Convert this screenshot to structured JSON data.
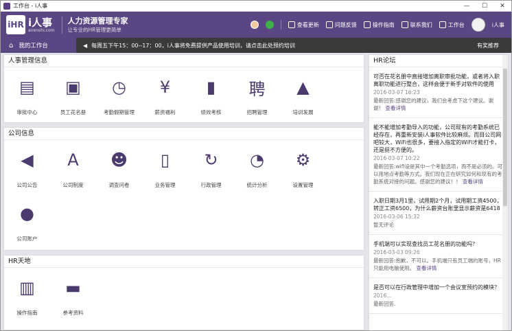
{
  "window": {
    "title": "工作台 - i人事",
    "min": "—",
    "max": "☐",
    "close": "✕"
  },
  "header": {
    "logo_mark": "iHR",
    "logo_name": "i人事",
    "logo_site": "airenshi.com",
    "slogan_main": "人力资源管理专家",
    "slogan_sub": "让专业的HR管理更简单",
    "actions": [
      {
        "label": "查看更新",
        "icon": "update-icon"
      },
      {
        "label": "问题反馈",
        "icon": "feedback-icon"
      },
      {
        "label": "操作指南",
        "icon": "book-icon"
      },
      {
        "label": "联系我们",
        "icon": "phone-icon"
      },
      {
        "label": "工作台",
        "icon": "home-icon"
      }
    ],
    "user": "i人事"
  },
  "nav": {
    "home": "我的工作台",
    "notice": "每周五下午15：00--17：00，i人事将免费提供产品使用培训，请点击此处预约培训",
    "recommend": "有奖推荐"
  },
  "hr_panel": {
    "title": "人事管理信息",
    "items": [
      {
        "label": "审批中心",
        "icon": "approval-icon"
      },
      {
        "label": "员工花名册",
        "icon": "roster-icon"
      },
      {
        "label": "考勤假期管理",
        "icon": "clock-icon"
      },
      {
        "label": "薪资福利",
        "icon": "money-icon"
      },
      {
        "label": "绩效考核",
        "icon": "chart-icon"
      },
      {
        "label": "招聘管理",
        "icon": "recruit-icon"
      },
      {
        "label": "培训发展",
        "icon": "graduation-icon"
      }
    ]
  },
  "company_panel": {
    "title": "公司信息",
    "items": [
      {
        "label": "公司公告",
        "icon": "megaphone-icon"
      },
      {
        "label": "公司制度",
        "icon": "compass-icon"
      },
      {
        "label": "调查问卷",
        "icon": "survey-icon"
      },
      {
        "label": "业务管理",
        "icon": "clipboard-icon"
      },
      {
        "label": "行政管理",
        "icon": "cycle-icon"
      },
      {
        "label": "统计分析",
        "icon": "pie-icon"
      },
      {
        "label": "设置管理",
        "icon": "gear-icon"
      },
      {
        "label": "公司账户",
        "icon": "account-icon"
      }
    ]
  },
  "hr_world": {
    "title": "HR天地",
    "items": [
      {
        "label": "操作指南",
        "icon": "open-book-icon"
      },
      {
        "label": "参考资料",
        "icon": "folder-icon"
      }
    ]
  },
  "forum": {
    "title": "HR论坛",
    "posts": [
      {
        "q": "可否在花名册中直接增加离职审批功能，或者将入职离职功能进行整合，这样会便于新手对软件的使用",
        "d": "2016-03-07 16:23",
        "a": "最新回答:感谢您的建议，我们会考虑下这个建议。谢谢！",
        "more": "查看详情"
      },
      {
        "q": "能不能增加考勤导入的功能，公司现有的考勤系统已经存在，再重新安装i人事软件比较麻烦。而目公司网吧较大，WiFi也很多，要接入指定的WiFi才能打卡，还是挺不方便的。",
        "d": "2016-03-07 10:22",
        "a": "最新回答:wifi设是其中一个考勤选项，而不是必须的。可以用地点考勤等方式。我们现在正在研究如何和现有的考勤系统对接的问题。感谢您的建议！！",
        "more": "查看详情"
      },
      {
        "q": "入职日期3月1里，试用期2个月，试用期工资4500，转正工资6500，为什么薪资台账里显示薪资是6418",
        "d": "2016-03-06 15:32",
        "a": "暂无评论",
        "more": ""
      },
      {
        "q": "手机端可以实现查找员工花名册的功能吗？",
        "d": "2016-03-03 09:26",
        "a": "最新回答:抱歉，不可以。手机端只有员工端的账号，HR只能用电脑使用。",
        "more": "查看详情"
      },
      {
        "q": "是否可以在行政管理中增加一个会议室预约的模块？",
        "d": "2016...",
        "a": "最新回答.",
        "more": ""
      }
    ]
  }
}
